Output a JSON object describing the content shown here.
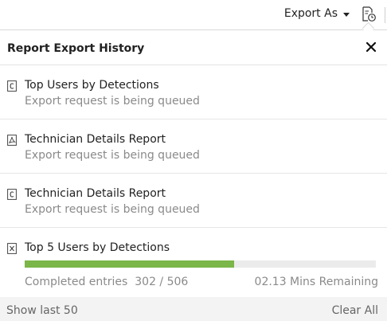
{
  "toolbar": {
    "export_label": "Export As",
    "export_caret_icon": "caret-down-icon",
    "history_icon": "report-history-icon"
  },
  "panel": {
    "title": "Report Export History",
    "close_icon": "close-icon",
    "items": [
      {
        "icon": "csv-file-icon",
        "title": "Top Users by Detections",
        "status": "Export request is being queued"
      },
      {
        "icon": "pdf-file-icon",
        "title": "Technician Details Report",
        "status": "Export request is being queued"
      },
      {
        "icon": "csv-file-icon",
        "title": "Technician Details Report",
        "status": "Export request is being queued"
      },
      {
        "icon": "excel-file-icon",
        "title": "Top 5 Users by Detections",
        "progress": {
          "completed": 302,
          "total": 506,
          "fraction": 0.597,
          "completed_label": "Completed entries",
          "completed_value": "302 / 506",
          "remaining": "02.13 Mins Remaining"
        }
      }
    ]
  },
  "footer": {
    "show_last": "Show last 50",
    "clear_all": "Clear All"
  },
  "colors": {
    "progress_fill": "#7ab648",
    "progress_track": "#ebebeb",
    "muted_text": "#8a8a8a"
  }
}
